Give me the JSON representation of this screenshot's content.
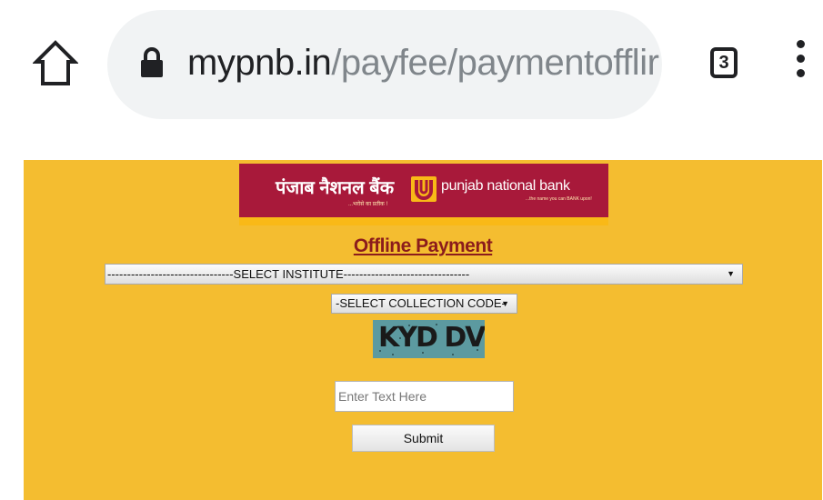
{
  "browser": {
    "url_host": "mypnb.in",
    "url_path": "/payfee/paymentofflir",
    "tab_count": "3",
    "icons": [
      "home-icon",
      "lock-icon",
      "tab-switcher-icon",
      "more-menu-icon"
    ]
  },
  "logo": {
    "hindi_name": "पंजाब नैशनल बैंक",
    "hindi_tagline": "...भरोसे का प्रतीक !",
    "english_name": "punjab national bank",
    "english_tagline": "...the name you can BANK upon!",
    "colors": {
      "red": "#a8193a",
      "yellow": "#f9b917"
    }
  },
  "form": {
    "title": "Offline Payment",
    "institute_select": "--------------------------------SELECT INSTITUTE--------------------------------",
    "collection_code_select": "-SELECT COLLECTION CODE-",
    "captcha_text": "KYD DV",
    "captcha_placeholder": "Enter Text Here",
    "submit_label": "Submit"
  },
  "colors": {
    "page_background": "#f4bd30",
    "title": "#8b1c1c"
  }
}
